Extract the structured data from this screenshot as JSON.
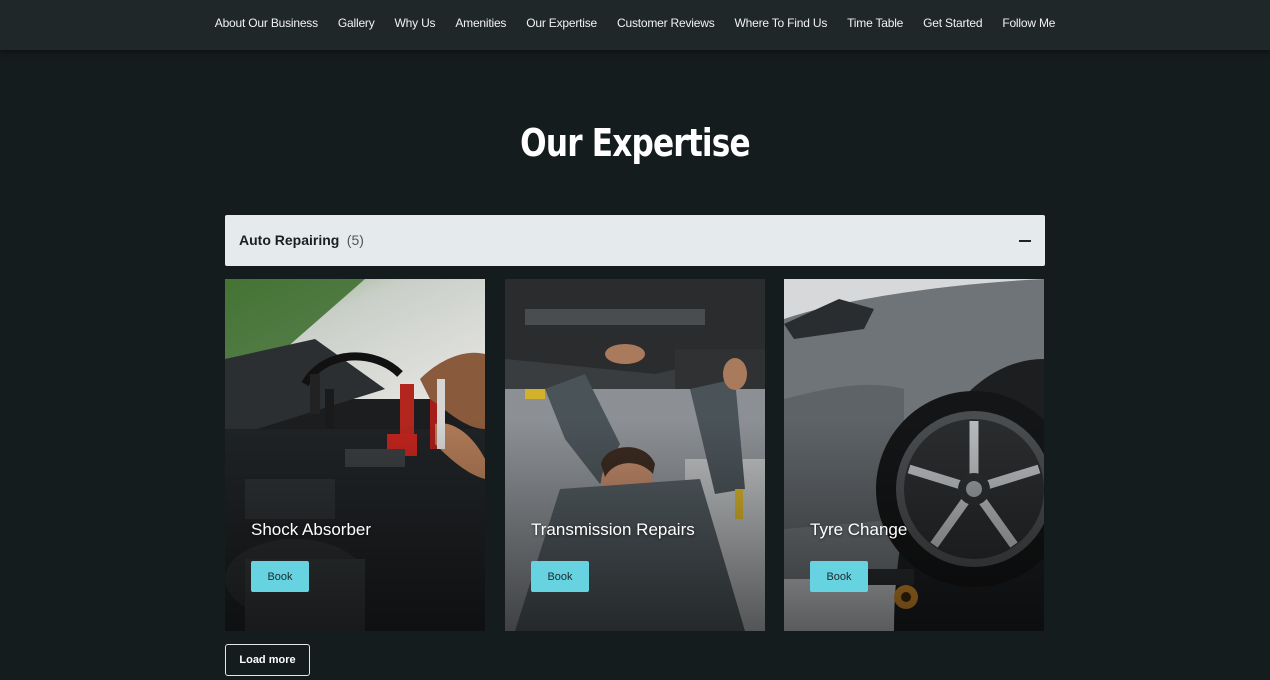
{
  "nav": {
    "items": [
      {
        "label": "About Our Business"
      },
      {
        "label": "Gallery"
      },
      {
        "label": "Why Us"
      },
      {
        "label": "Amenities"
      },
      {
        "label": "Our Expertise"
      },
      {
        "label": "Customer Reviews"
      },
      {
        "label": "Where To Find Us"
      },
      {
        "label": "Time Table"
      },
      {
        "label": "Get Started"
      },
      {
        "label": "Follow Me"
      }
    ]
  },
  "section": {
    "title": "Our Expertise"
  },
  "accordion": {
    "label": "Auto Repairing",
    "count": "(5)",
    "icon": "minus-icon"
  },
  "cards": [
    {
      "title": "Shock Absorber",
      "button": "Book",
      "image": "engine-jumper-cables-photo"
    },
    {
      "title": "Transmission Repairs",
      "button": "Book",
      "image": "mechanic-under-car-photo"
    },
    {
      "title": "Tyre Change",
      "button": "Book",
      "image": "car-wheel-tyre-photo"
    }
  ],
  "load_more": "Load more",
  "colors": {
    "background": "#151c1e",
    "nav_background": "#1f2729",
    "accordion_background": "#e5ebed",
    "button_accent": "#67d3e0"
  }
}
